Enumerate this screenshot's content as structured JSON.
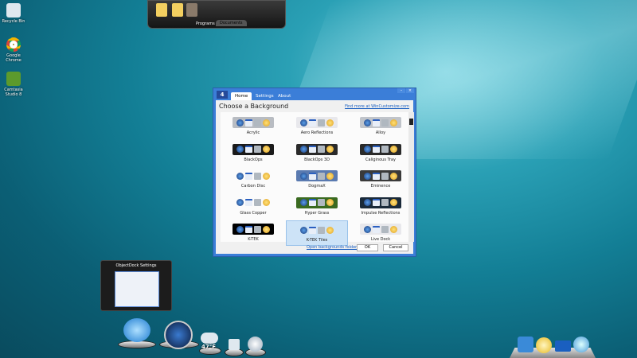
{
  "desktop": {
    "icons": [
      {
        "label": "Recycle Bin"
      },
      {
        "label": "Google Chrome"
      },
      {
        "label": "Camtasia Studio 8"
      }
    ]
  },
  "stack": {
    "tabs": [
      "Programs",
      "Documents"
    ],
    "active": "Documents"
  },
  "dialog": {
    "logo": "4",
    "tabs": [
      "Home",
      "Settings",
      "About"
    ],
    "active_tab": "Home",
    "title": "Choose a Background",
    "find_more": "Find more at WinCustomize.com",
    "backgrounds": [
      "Acrylic",
      "Aero Reflections",
      "Alloy",
      "BlackOps",
      "BlackOps 3D",
      "Caliginous Tray",
      "Carbon Disc",
      "DogmaX",
      "Eminence",
      "Glass Copper",
      "Hyper Grass",
      "Impulse Reflections",
      "K-TEK",
      "K-TEK Tiles",
      "Live Dock"
    ],
    "selected": "K-TEK Tiles",
    "open_folder": "Open backgrounds folder",
    "ok": "OK",
    "cancel": "Cancel"
  },
  "thumbnail": {
    "title": "ObjectDock Settings"
  },
  "dock": {
    "weather_temp": "47°F"
  },
  "colors": {
    "titlebar": "#3b7ed8",
    "link": "#1a5fc0",
    "selection": "#cde3f7"
  }
}
